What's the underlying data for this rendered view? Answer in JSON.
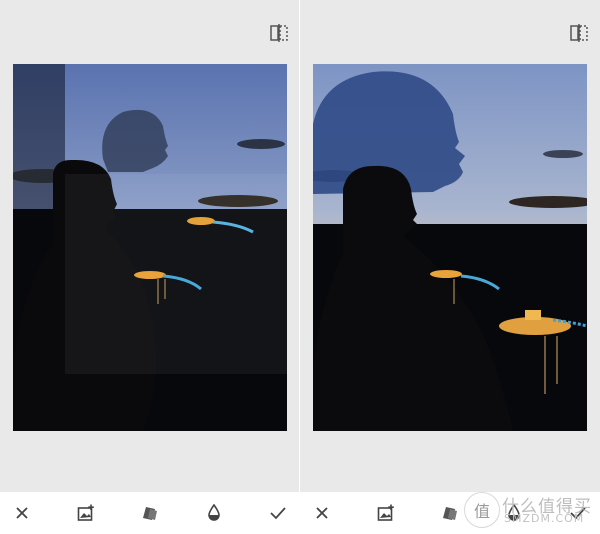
{
  "colors": {
    "background": "#e9e9e9",
    "toolbar": "#ffffff",
    "icon": "#444444"
  },
  "panels": [
    {
      "id": "left",
      "compare_icon": "compare-split-icon",
      "photo": "double-exposure-silhouette-sunset-offset"
    },
    {
      "id": "right",
      "compare_icon": "compare-split-icon",
      "photo": "double-exposure-silhouette-sunset-blended"
    }
  ],
  "toolbar": {
    "tools": [
      {
        "name": "cancel",
        "icon": "close-icon"
      },
      {
        "name": "add-image",
        "icon": "add-image-icon"
      },
      {
        "name": "blend-style",
        "icon": "layers-icon"
      },
      {
        "name": "opacity",
        "icon": "droplet-icon"
      },
      {
        "name": "apply",
        "icon": "check-icon"
      }
    ]
  },
  "watermark": {
    "title": "什么值得买",
    "subtitle": "SMZDM.COM",
    "logo_text": "值"
  }
}
